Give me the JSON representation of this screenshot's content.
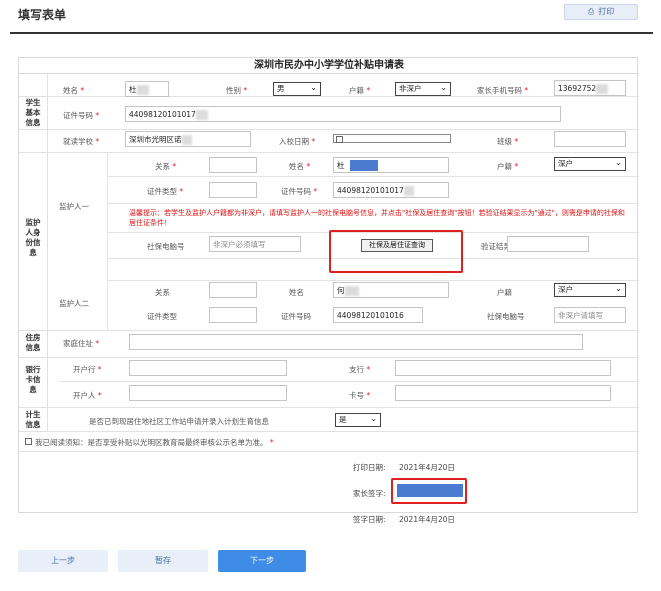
{
  "page": {
    "title": "填写表单",
    "print_label": "打印",
    "print_icon": "printer-icon"
  },
  "form": {
    "title": "深圳市民办中小学学位补贴申请表",
    "sections": {
      "student": "学生\n基本\n信息",
      "guardian": "监护\n人身\n份信\n息",
      "residence": "住房\n信息",
      "bank": "银行\n卡信\n息",
      "planning": "计生\n信息"
    },
    "student": {
      "name_label": "姓名",
      "name_value": "杜",
      "gender_label": "性别",
      "gender_value": "男",
      "hukou_label": "户籍",
      "hukou_value": "非深户",
      "parent_phone_label": "家长手机号码",
      "parent_phone_value": "13692752",
      "id_label": "证件号码",
      "id_value": "44098120101017",
      "school_label": "就读学校",
      "school_value": "深圳市光明区诺",
      "enroll_date_label": "入校日期",
      "enroll_date_value": "",
      "class_label": "班级",
      "class_value": ""
    },
    "guardian1": {
      "heading": "监护人一",
      "relation_label": "关系",
      "relation_value": "",
      "name_label": "姓名",
      "name_value": "杜",
      "hukou_label": "户籍",
      "hukou_value": "深户",
      "id_type_label": "证件类型",
      "id_type_value": "",
      "id_label": "证件号码",
      "id_value": "44098120101017",
      "notice": "温馨提示：若学生及监护人户籍都为非深户，请填写监护人一的社保电脑号信息，并点击\"社保及居住查询\"按钮！若验证结果显示为\"通过\"，则需是申请的社保和居住证条件！",
      "ss_label": "社保电脑号",
      "ss_placeholder": "非深户必须填写",
      "query_button": "社保及居住证查询",
      "verify_label": "验证结果:",
      "verify_value": ""
    },
    "guardian2": {
      "heading": "监护人二",
      "relation_label": "关系",
      "relation_value": "",
      "name_label": "姓名",
      "name_value": "何",
      "hukou_label": "户籍",
      "hukou_value": "深户",
      "id_type_label": "证件类型",
      "id_type_value": "",
      "id_label": "证件号码",
      "id_value": "44098120101016",
      "ss_label": "社保电脑号",
      "ss_placeholder": "非深户请填写"
    },
    "residence": {
      "address_label": "家庭住址",
      "address_value": ""
    },
    "bank": {
      "bank_label": "开户行",
      "bank_value": "",
      "branch_label": "支行",
      "branch_value": "",
      "holder_label": "开户人",
      "holder_value": "",
      "card_label": "卡号",
      "card_value": ""
    },
    "planning": {
      "question": "是否已到现居住地社区工作站申请并录入计划生育信息",
      "answer": "是"
    },
    "agreement": "我已阅读须知：是否享受补贴以光明区教育局最终审核公示名单为准。",
    "print_date_label": "打印日期:",
    "print_date_value": "2021年4月20日",
    "signature_label": "家长签字:",
    "sign_date_label": "签字日期:",
    "sign_date_value": "2021年4月20日"
  },
  "buttons": {
    "prev": "上一步",
    "save": "暂存",
    "next": "下一步"
  },
  "colors": {
    "required": "#e02020",
    "primary": "#3e8ce5",
    "highlight": "#e02020",
    "redacted": "#4a7bd0"
  }
}
